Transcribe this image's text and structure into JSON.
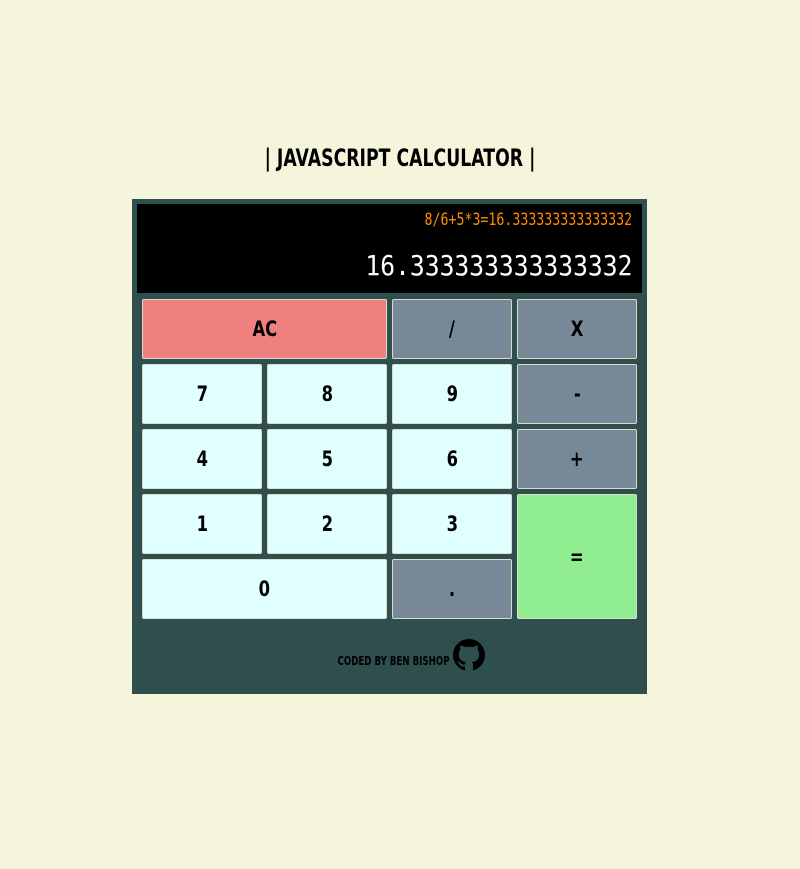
{
  "page": {
    "title": "| JAVASCRIPT CALCULATOR |"
  },
  "display": {
    "formula": "8/6+5*3=16.333333333333332",
    "output": "16.333333333333332"
  },
  "buttons": {
    "clear": "AC",
    "divide": "/",
    "multiply": "X",
    "subtract": "-",
    "add": "+",
    "equals": "=",
    "decimal": ".",
    "zero": "0",
    "one": "1",
    "two": "2",
    "three": "3",
    "four": "4",
    "five": "5",
    "six": "6",
    "seven": "7",
    "eight": "8",
    "nine": "9"
  },
  "footer": {
    "credit": "CODED BY BEN BISHOP",
    "icon": "github-icon"
  },
  "colors": {
    "page_background": "#f5f5dc",
    "calculator_body": "#2f4f4f",
    "display_background": "#000000",
    "formula_text": "#ff8c00",
    "output_text": "#ffffff",
    "number_button": "#e0ffff",
    "operator_button": "#778899",
    "clear_button": "#f08080",
    "equals_button": "#90ee90"
  }
}
